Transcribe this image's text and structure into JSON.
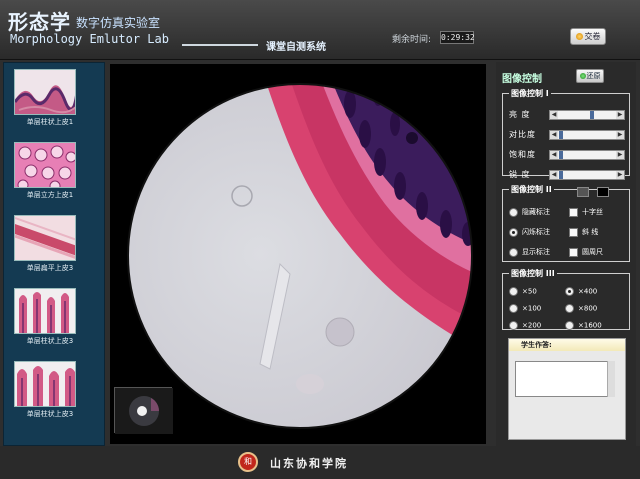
{
  "header": {
    "brand_cn": "形态学",
    "brand_sub": "数字仿真实验室",
    "brand_en": "Morphology Emlutor Lab",
    "mode_title": "课堂自测系统",
    "timer_label": "剩余时间:",
    "timer_value": "0:29:32",
    "submit_label": "交卷"
  },
  "thumbnails": [
    {
      "caption": "单层柱状上皮1"
    },
    {
      "caption": "单层立方上皮1"
    },
    {
      "caption": "单层扁平上皮3"
    },
    {
      "caption": "单层柱状上皮3"
    },
    {
      "caption": "单层柱状上皮3"
    }
  ],
  "panel": {
    "title": "图像控制",
    "reset_label": "还原",
    "group1": {
      "legend": "图像控制 I",
      "sliders": [
        {
          "label": "亮  度",
          "value": 0.55
        },
        {
          "label": "对比度",
          "value": 0.0
        },
        {
          "label": "饱和度",
          "value": 0.0
        },
        {
          "label": "锐  度",
          "value": 0.0
        }
      ]
    },
    "group2": {
      "legend": "图像控制 II",
      "options": [
        {
          "label": "隐藏标注",
          "type": "radio",
          "checked": false
        },
        {
          "label": "十字丝",
          "type": "check",
          "checked": false
        },
        {
          "label": "闪烁标注",
          "type": "radio",
          "checked": true
        },
        {
          "label": "斜  线",
          "type": "check",
          "checked": false
        },
        {
          "label": "显示标注",
          "type": "radio",
          "checked": false
        },
        {
          "label": "圆周尺",
          "type": "check",
          "checked": false
        }
      ],
      "swatch_colors": [
        "#555555",
        "#000000"
      ]
    },
    "group3": {
      "legend": "图像控制 III",
      "options": [
        {
          "label": "×50",
          "checked": false
        },
        {
          "label": "×400",
          "checked": true
        },
        {
          "label": "×100",
          "checked": false
        },
        {
          "label": "×800",
          "checked": false
        },
        {
          "label": "×200",
          "checked": false
        },
        {
          "label": "×1600",
          "checked": false
        }
      ]
    },
    "answer_title": "学生作答:"
  },
  "footer": {
    "seal": "和",
    "school": "山东协和学院"
  },
  "colors": {
    "accent": "#c7ffe1",
    "stain_pink": "#d8426f",
    "stain_purple": "#3b1c5c"
  }
}
